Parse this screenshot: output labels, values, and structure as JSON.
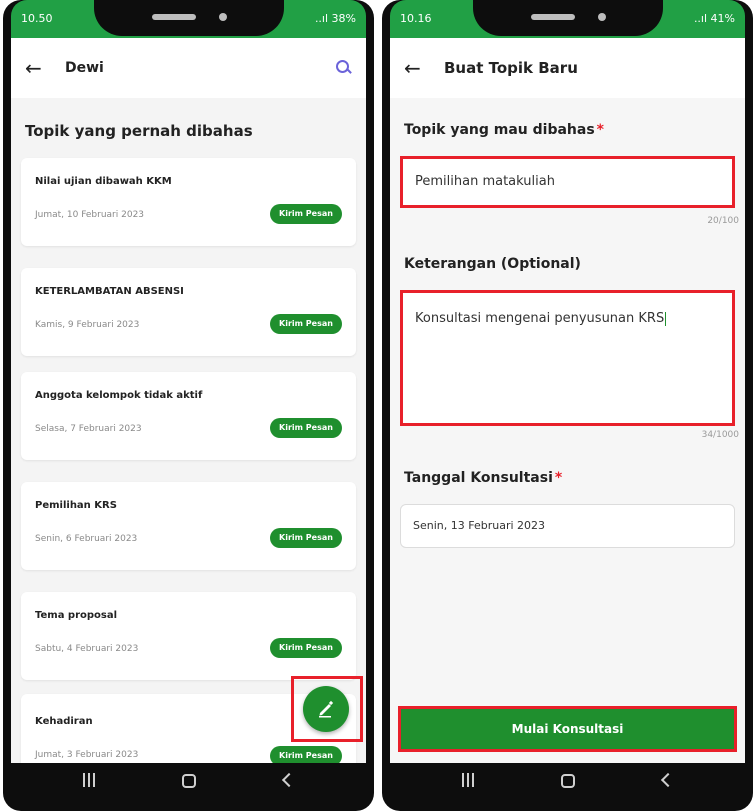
{
  "left_screen": {
    "statusbar": {
      "time": "10.50",
      "signal": "..ıl 38%"
    },
    "appbar": {
      "title": "Dewi"
    },
    "section_title": "Topik yang pernah dibahas",
    "topics": [
      {
        "title": "Nilai ujian dibawah KKM",
        "date": "Jumat, 10 Februari 2023",
        "button": "Kirim Pesan"
      },
      {
        "title": "KETERLAMBATAN ABSENSI",
        "date": "Kamis, 9 Februari 2023",
        "button": "Kirim Pesan"
      },
      {
        "title": "Anggota kelompok tidak aktif",
        "date": "Selasa, 7 Februari 2023",
        "button": "Kirim Pesan"
      },
      {
        "title": "Pemilihan KRS",
        "date": "Senin, 6 Februari 2023",
        "button": "Kirim Pesan"
      },
      {
        "title": "Tema proposal",
        "date": "Sabtu, 4 Februari 2023",
        "button": "Kirim Pesan"
      },
      {
        "title": "Kehadiran",
        "date": "Jumat, 3 Februari 2023",
        "button": "Kirim Pesan"
      }
    ]
  },
  "right_screen": {
    "statusbar": {
      "time": "10.16",
      "signal": "..ıl 41%"
    },
    "appbar": {
      "title": "Buat Topik Baru"
    },
    "topic_field": {
      "label": "Topik yang mau dibahas",
      "required_mark": "*",
      "value": "Pemilihan matakuliah",
      "counter": "20/100"
    },
    "notes_field": {
      "label": "Keterangan (Optional)",
      "value": "Konsultasi mengenai penyusunan KRS",
      "counter": "34/1000"
    },
    "date_field": {
      "label": "Tanggal Konsultasi",
      "required_mark": "*",
      "value": "Senin, 13 Februari 2023"
    },
    "submit_button": "Mulai Konsultasi"
  },
  "colors": {
    "brand_green": "#1f8f2e",
    "statusbar_green": "#21a045",
    "highlight_red": "#e8202a",
    "search_purple": "#6b63d9"
  }
}
